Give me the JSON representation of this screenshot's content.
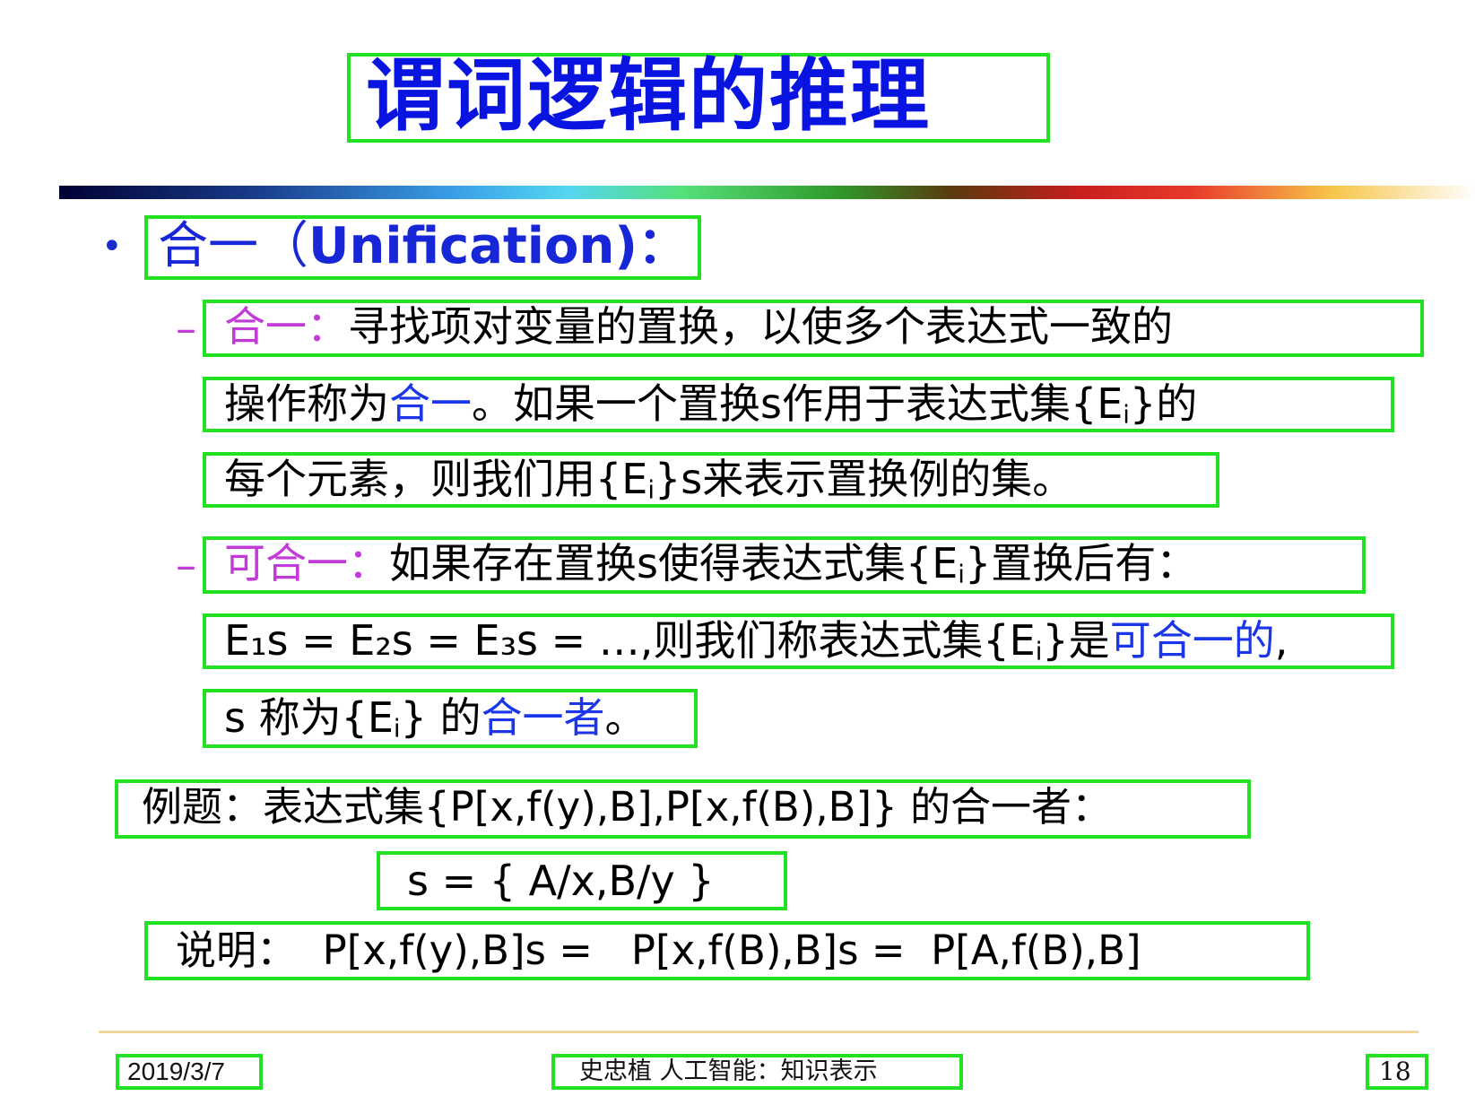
{
  "slide": {
    "title": "谓词逻辑的推理",
    "heading": {
      "bullet": "•",
      "label_cn": "合一（",
      "label_en": "Unification",
      "label_end": ")："
    },
    "item1": {
      "dash": "–",
      "term": "合一：",
      "text1": "寻找项对变量的置换，以使多个表达式一致的",
      "text2a": "操作称为",
      "text2b": "合一",
      "text2c": "。如果一个置换s作用于表达式集{E",
      "text2d": "i",
      "text2e": "}的",
      "text3a": "每个元素，则我们用{E",
      "text3b": "i",
      "text3c": "}s来表示置换例的集。"
    },
    "item2": {
      "dash": "–",
      "term": "可合一：",
      "text1a": "如果存在置换s使得表达式集{E",
      "text1b": "i",
      "text1c": "}置换后有：",
      "text2": "E₁s = E₂s = E₃s = …,则我们称表达式集{E",
      "text2b": "i",
      "text2c": "}是",
      "text2d": "可合一的",
      "text2e": ",",
      "text3a": "s 称为{E",
      "text3b": "i",
      "text3c": "} 的",
      "text3d": "合一者",
      "text3e": "。"
    },
    "example": {
      "line1": "例题：表达式集{P[x,f(y),B],P[x,f(B),B]} 的合一者：",
      "line2": "s = { A/x,B/y }",
      "line3": "说明：  P[x,f(y),B]s =   P[x,f(B),B]s =  P[A,f(B),B]"
    },
    "footer": {
      "date": "2019/3/7",
      "center": "史忠植 人工智能：知识表示",
      "page": "18"
    }
  }
}
